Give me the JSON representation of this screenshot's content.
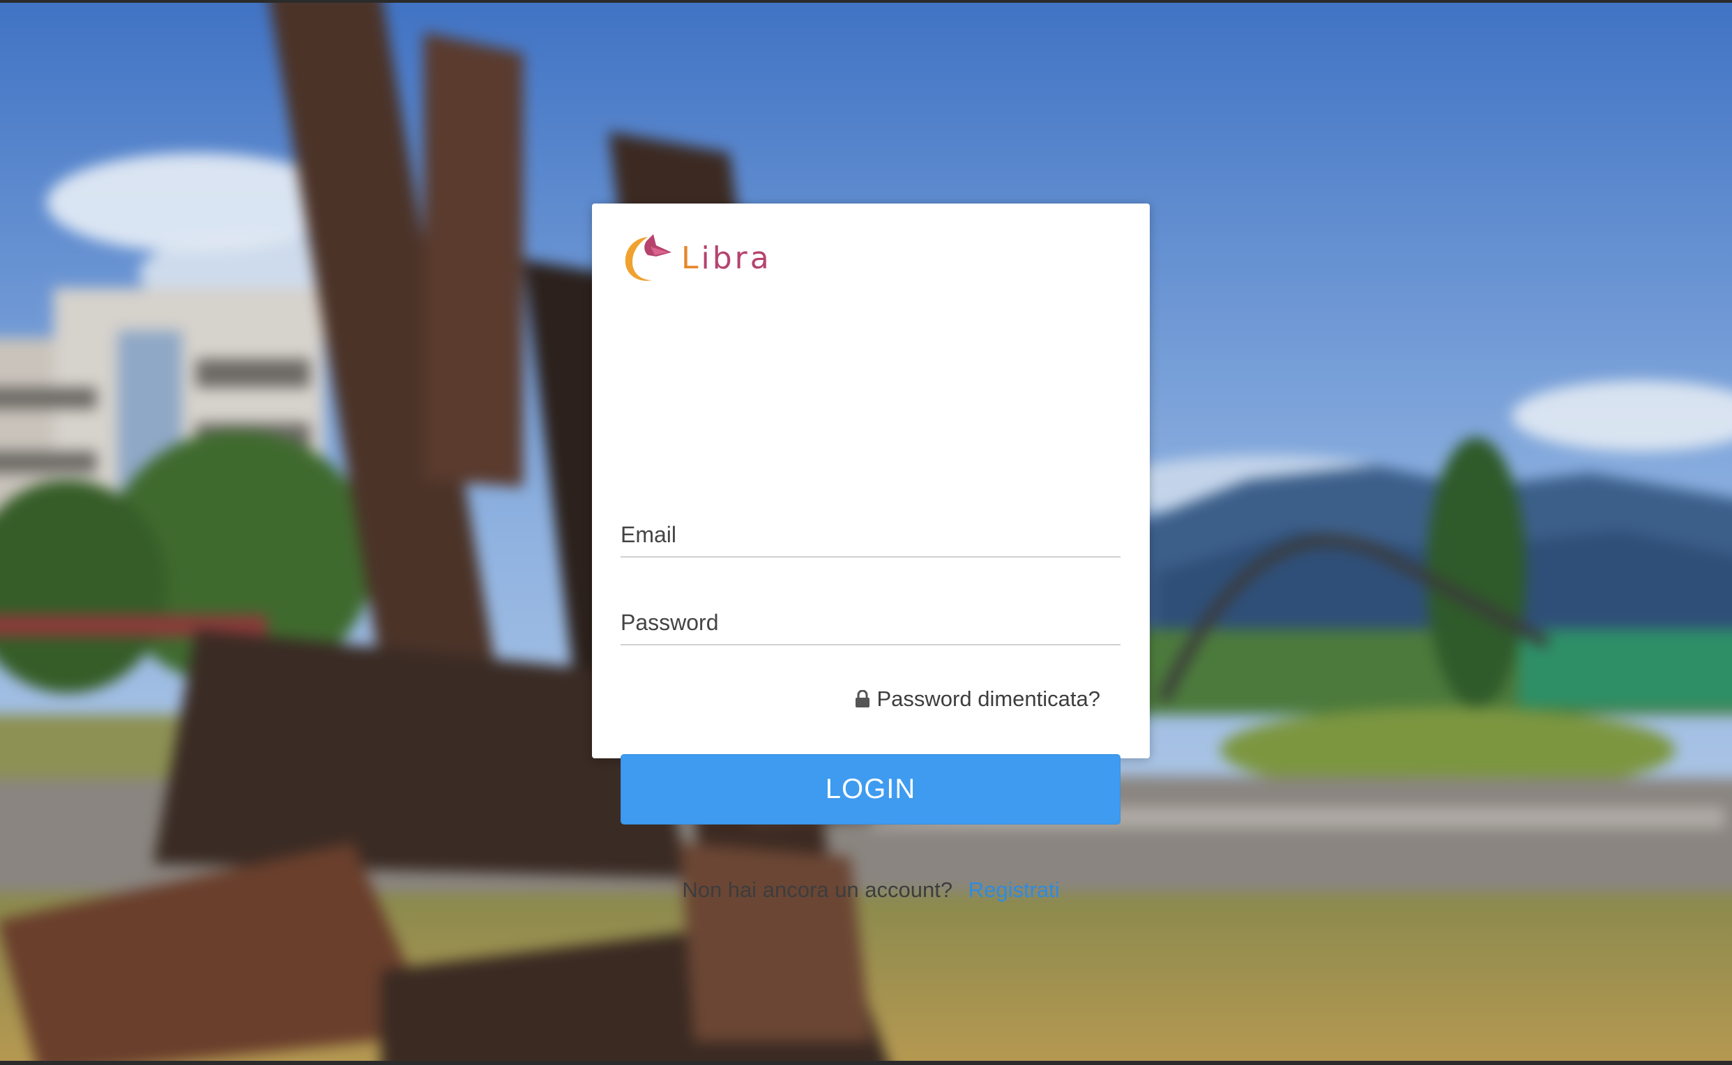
{
  "brand": {
    "logo_text_first": "L",
    "logo_text_rest": "ibra",
    "logo_icon": "libra-logo-icon",
    "color_primary": "#b5436e",
    "color_accent": "#e7862a"
  },
  "form": {
    "email_placeholder": "Email",
    "password_placeholder": "Password",
    "email_value": "",
    "password_value": "",
    "forgot_label": "Password dimenticata?",
    "forgot_icon": "lock-icon",
    "login_label": "LOGIN",
    "login_color": "#3e9bf0"
  },
  "signup": {
    "prompt": "Non hai ancora un account?",
    "link_label": "Registrati",
    "link_color": "#2f8be0"
  }
}
